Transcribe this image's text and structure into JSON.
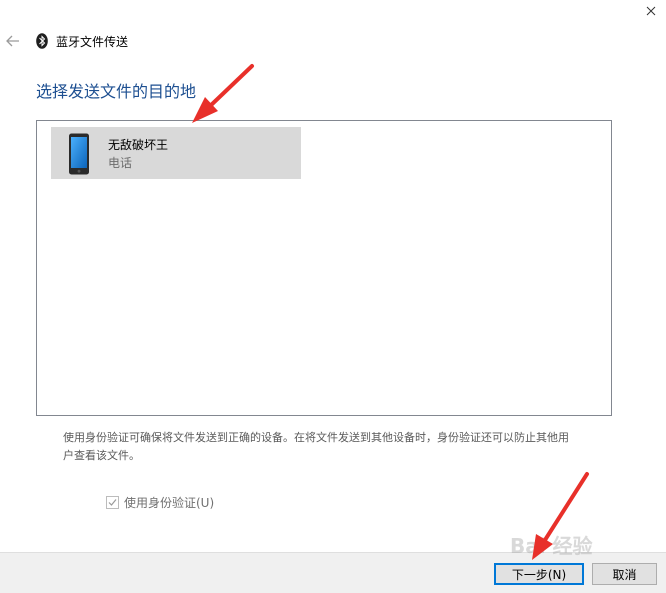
{
  "window": {
    "title": "蓝牙文件传送"
  },
  "heading": "选择发送文件的目的地",
  "devices": [
    {
      "name": "无敌破坏王",
      "type": "电话",
      "selected": true
    }
  ],
  "auth": {
    "description": "使用身份验证可确保将文件发送到正确的设备。在将文件发送到其他设备时，身份验证还可以防止其他用户查看该文件。",
    "checkbox_label": "使用身份验证(U)",
    "checked": true,
    "enabled": false
  },
  "buttons": {
    "next": "下一步(N)",
    "cancel": "取消"
  },
  "watermark": "Bai 经验",
  "colors": {
    "heading": "#1d4f91",
    "selection": "#d9d9d9",
    "annotation_arrow": "#e8302a",
    "button_focus": "#0078d7"
  },
  "icons": {
    "back": "back-arrow-icon",
    "bluetooth": "bluetooth-icon",
    "device": "smartphone-icon",
    "close": "close-icon"
  }
}
